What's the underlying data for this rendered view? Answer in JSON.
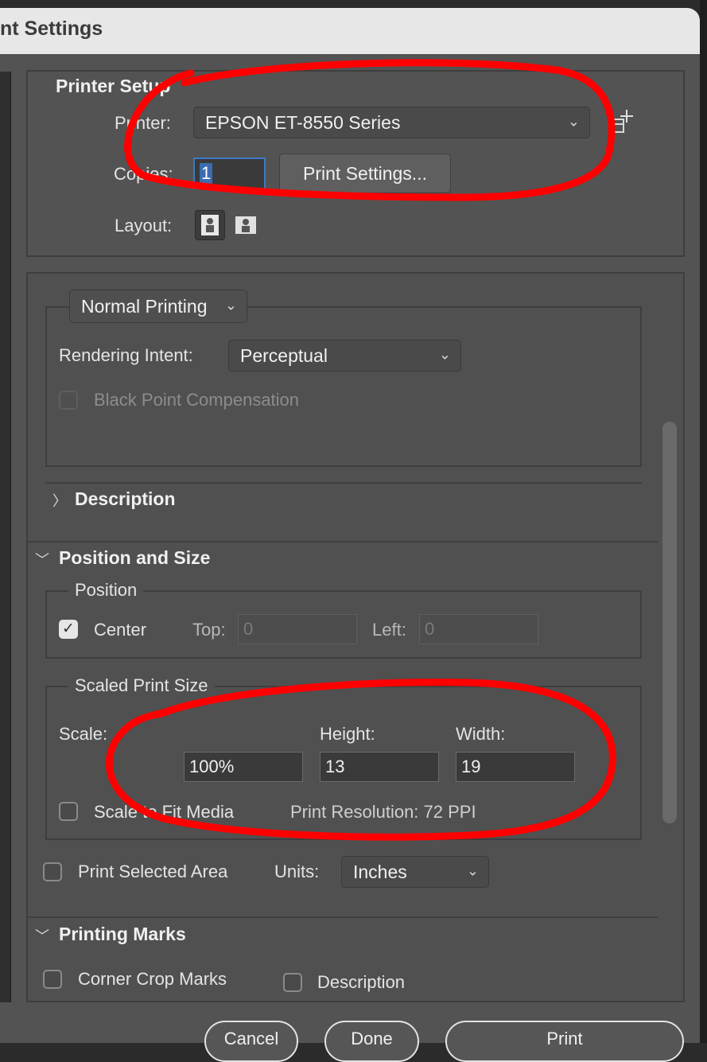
{
  "window": {
    "title": "nt Settings"
  },
  "printer_setup": {
    "heading": "Printer Setup",
    "printer_label": "Printer:",
    "printer_value": "EPSON ET-8550 Series",
    "copies_label": "Copies:",
    "copies_value": "1",
    "print_settings_button": "Print Settings...",
    "layout_label": "Layout:",
    "layout_options": [
      "portrait-layout-icon",
      "landscape-layout-icon"
    ],
    "selected_layout": "portrait"
  },
  "color_management": {
    "mode_value": "Normal Printing",
    "rendering_intent_label": "Rendering Intent:",
    "rendering_intent_value": "Perceptual",
    "black_point_label": "Black Point Compensation",
    "black_point_checked": false
  },
  "description_section": {
    "label": "Description",
    "expanded": false
  },
  "position_and_size": {
    "label": "Position and Size",
    "position_group": "Position",
    "center_label": "Center",
    "center_checked": true,
    "top_label": "Top:",
    "top_value": "0",
    "left_label": "Left:",
    "left_value": "0",
    "scaled_group": "Scaled Print Size",
    "scale_label": "Scale:",
    "scale_value": "100%",
    "height_label": "Height:",
    "height_value": "13",
    "width_label": "Width:",
    "width_value": "19",
    "scale_to_fit_label": "Scale to Fit Media",
    "scale_to_fit_checked": false,
    "print_resolution": "Print Resolution: 72 PPI",
    "print_selected_area_label": "Print Selected Area",
    "print_selected_area_checked": false,
    "units_label": "Units:",
    "units_value": "Inches"
  },
  "printing_marks": {
    "label": "Printing Marks",
    "corner_crop_label": "Corner Crop Marks",
    "corner_crop_checked": false,
    "description_label": "Description",
    "description_checked": false
  },
  "buttons": {
    "cancel": "Cancel",
    "done": "Done",
    "print": "Print"
  },
  "colors": {
    "annotation": "#ff0000",
    "dialog_bg": "#535353",
    "titlebar_bg": "#e7e7e7"
  }
}
